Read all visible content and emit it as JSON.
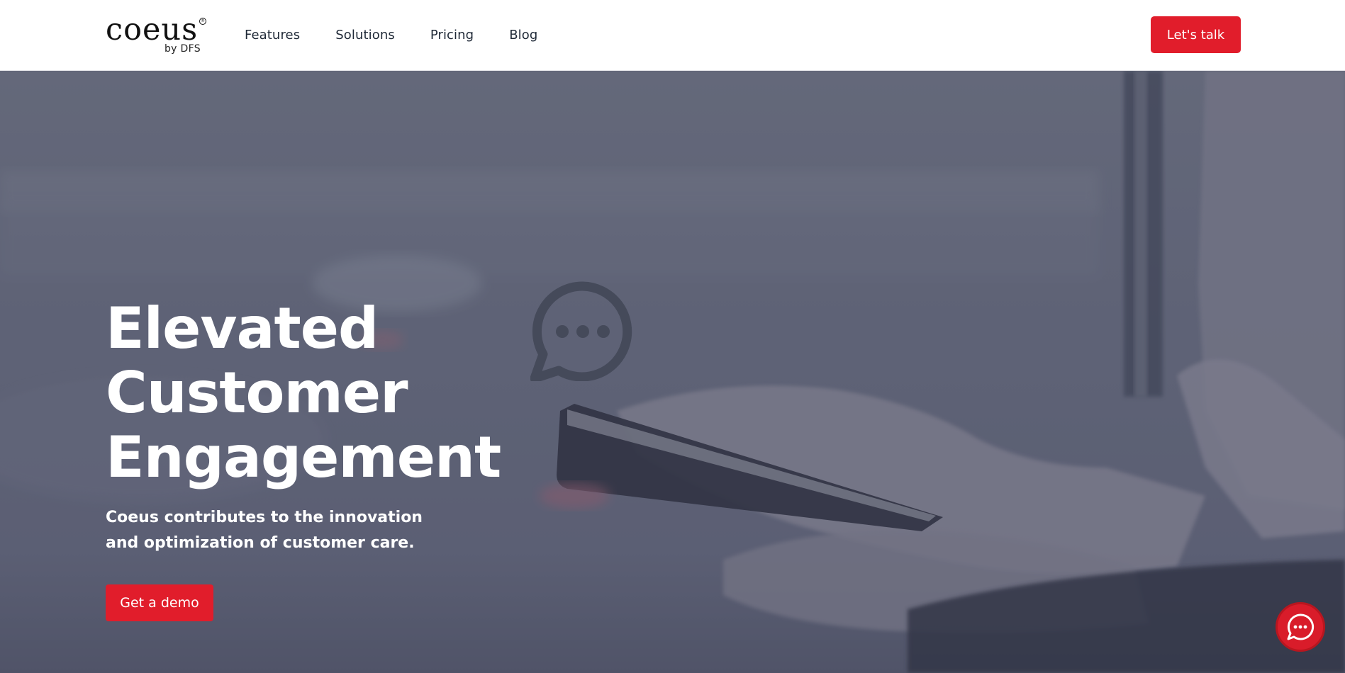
{
  "brand": {
    "name": "coeus",
    "tagline": "by DFS",
    "registered_mark": "®"
  },
  "nav": {
    "items": [
      {
        "label": "Features"
      },
      {
        "label": "Solutions"
      },
      {
        "label": "Pricing"
      },
      {
        "label": "Blog"
      }
    ],
    "cta_label": "Let's talk"
  },
  "hero": {
    "title_lines": [
      "Elevated",
      "Customer",
      "Engagement"
    ],
    "subtitle": "Coeus contributes to the innovation and optimization of customer care.",
    "cta_label": "Get a demo",
    "background_icon": "speech-bubble-ellipsis-icon"
  },
  "chat_widget": {
    "icon": "chat-bubble-icon"
  },
  "colors": {
    "accent": "#e11d2b",
    "text_dark": "#1f2937",
    "hero_overlay": "#5f6478"
  }
}
